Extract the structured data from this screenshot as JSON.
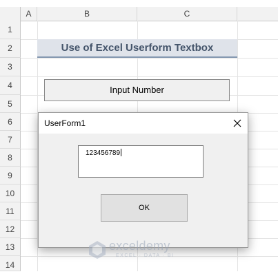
{
  "sheet": {
    "columns": [
      "A",
      "B",
      "C"
    ],
    "rows": [
      "1",
      "2",
      "3",
      "4",
      "5",
      "6",
      "7",
      "8",
      "9",
      "10",
      "11",
      "12",
      "13",
      "14"
    ],
    "title": "Use of Excel Userform Textbox",
    "input_button_label": "Input Number"
  },
  "userform": {
    "title": "UserForm1",
    "textbox_value": "123456789",
    "ok_label": "OK"
  },
  "watermark": {
    "name": "exceldemy",
    "tagline": "EXCEL · DATA · BI"
  },
  "colors": {
    "title_fill": "#dfe3ea",
    "title_text": "#44546a",
    "title_border": "#8497b0",
    "form_bg": "#f0f0f0"
  },
  "icons": {
    "close": "close-icon",
    "watermark_logo": "exceldemy-logo-icon"
  }
}
